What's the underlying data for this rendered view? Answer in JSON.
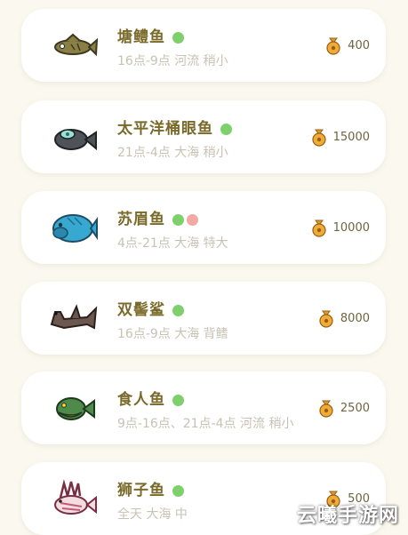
{
  "colors": {
    "background": "#fbf8ef",
    "card": "#ffffff",
    "name_text": "#7a6a2a",
    "info_text": "#c8c2b4",
    "green_dot": "#7ed06a",
    "pink_dot": "#f2a9a3"
  },
  "fish": [
    {
      "name": "塘鳢鱼",
      "info": "16点-9点 河流 稍小",
      "price": "400",
      "dots": [
        "green"
      ],
      "icon": "pond-smelt-fish-icon"
    },
    {
      "name": "太平洋桶眼鱼",
      "info": "21点-4点 大海 稍小",
      "price": "15000",
      "dots": [
        "green"
      ],
      "icon": "barreleye-fish-icon"
    },
    {
      "name": "苏眉鱼",
      "info": "4点-21点 大海 特大",
      "price": "10000",
      "dots": [
        "green",
        "pink"
      ],
      "icon": "napoleonfish-icon"
    },
    {
      "name": "双髻鲨",
      "info": "16点-9点 大海 背鳍",
      "price": "8000",
      "dots": [
        "green"
      ],
      "icon": "hammerhead-shark-icon"
    },
    {
      "name": "食人鱼",
      "info": "9点-16点、21点-4点 河流 稍小",
      "price": "2500",
      "dots": [
        "green"
      ],
      "icon": "piranha-icon"
    },
    {
      "name": "狮子鱼",
      "info": "全天 大海 中",
      "price": "500",
      "dots": [
        "green"
      ],
      "icon": "lionfish-icon"
    }
  ],
  "watermark": "云曦手游网"
}
